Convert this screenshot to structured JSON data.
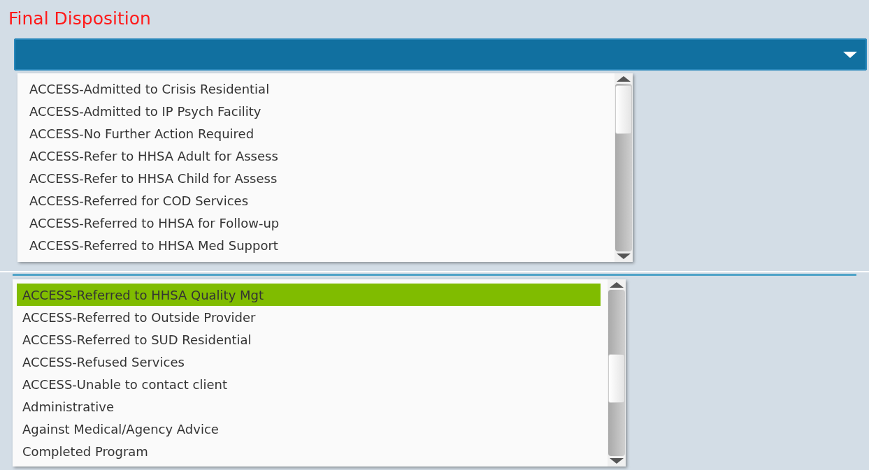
{
  "title": "Final Disposition",
  "dropdown": {
    "expanded": true
  },
  "lists": [
    {
      "items": [
        {
          "label": "ACCESS-Admitted to Crisis Residential",
          "selected": false
        },
        {
          "label": "ACCESS-Admitted to IP Psych Facility",
          "selected": false
        },
        {
          "label": "ACCESS-No Further Action Required",
          "selected": false
        },
        {
          "label": "ACCESS-Refer to HHSA Adult for Assess",
          "selected": false
        },
        {
          "label": "ACCESS-Refer to HHSA Child for Assess",
          "selected": false
        },
        {
          "label": "ACCESS-Referred for COD Services",
          "selected": false
        },
        {
          "label": "ACCESS-Referred to HHSA for Follow-up",
          "selected": false
        },
        {
          "label": "ACCESS-Referred to HHSA Med Support",
          "selected": false
        }
      ]
    },
    {
      "items": [
        {
          "label": "ACCESS-Referred to HHSA Quality Mgt",
          "selected": true
        },
        {
          "label": "ACCESS-Referred to Outside Provider",
          "selected": false
        },
        {
          "label": "ACCESS-Referred to SUD Residential",
          "selected": false
        },
        {
          "label": "ACCESS-Refused Services",
          "selected": false
        },
        {
          "label": "ACCESS-Unable to contact client",
          "selected": false
        },
        {
          "label": "Administrative",
          "selected": false
        },
        {
          "label": "Against Medical/Agency Advice",
          "selected": false
        },
        {
          "label": "Completed Program",
          "selected": false
        }
      ]
    }
  ]
}
